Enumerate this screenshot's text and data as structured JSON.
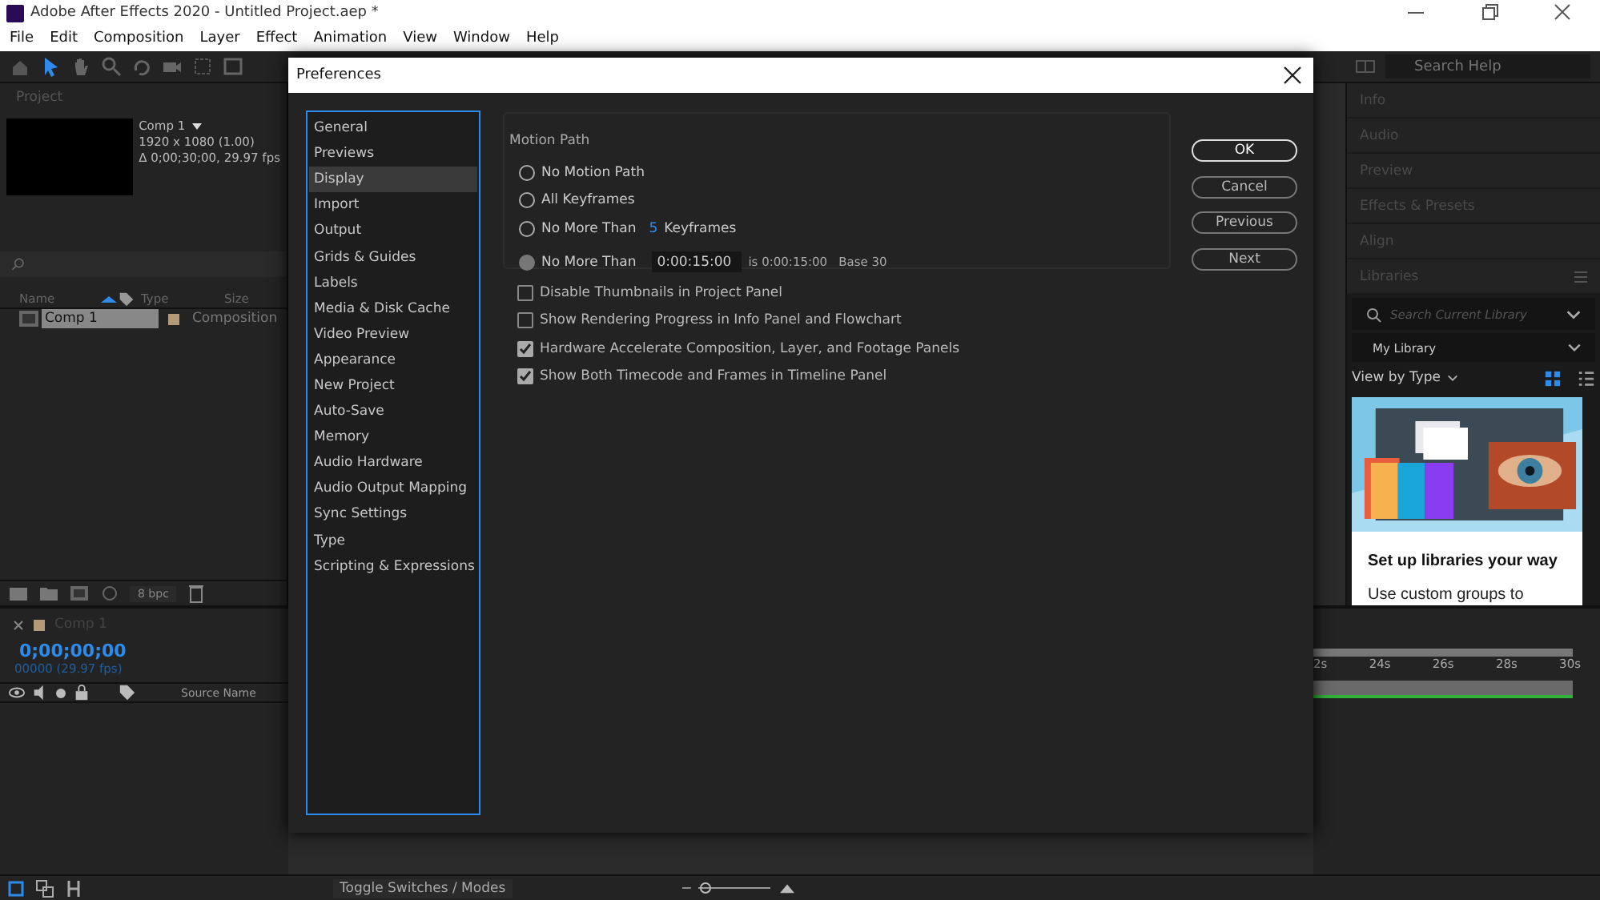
{
  "window": {
    "title": "Adobe After Effects 2020 - Untitled Project.aep *"
  },
  "menu": [
    "File",
    "Edit",
    "Composition",
    "Layer",
    "Effect",
    "Animation",
    "View",
    "Window",
    "Help"
  ],
  "search_help": {
    "placeholder": "Search Help"
  },
  "project_panel": {
    "title": "Project",
    "comp_name": "Comp 1",
    "comp_size": "1920 x 1080 (1.00)",
    "comp_duration": "Δ 0;00;30;00, 29.97 fps",
    "columns": [
      "Name",
      "Type",
      "Size"
    ],
    "rows": [
      {
        "name": "Comp 1",
        "type": "Composition",
        "selected": true
      }
    ],
    "bit_depth": "8 bpc"
  },
  "right_panels": [
    "Info",
    "Audio",
    "Preview",
    "Effects & Presets",
    "Align"
  ],
  "libraries": {
    "title": "Libraries",
    "search_placeholder": "Search Current Library",
    "library": "My Library",
    "view": "View by Type",
    "card_title": "Set up libraries your way",
    "card_text": "Use custom groups to"
  },
  "timeline": {
    "tab": "Comp 1",
    "timecode": "0;00;00;00",
    "frames": "00000 (29.97 fps)",
    "column": "Source Name",
    "ruler": [
      "2s",
      "24s",
      "26s",
      "28s",
      "30s"
    ],
    "toggle": "Toggle Switches / Modes",
    "zoom": {
      "level": 0.1
    }
  },
  "dialog": {
    "title": "Preferences",
    "categories": [
      {
        "label": "General",
        "selected": false
      },
      {
        "label": "Previews",
        "selected": false
      },
      {
        "label": "Display",
        "selected": true
      },
      {
        "label": "Import",
        "selected": false
      },
      {
        "label": "Output",
        "selected": false
      },
      {
        "label": "Grids & Guides",
        "selected": false
      },
      {
        "label": "Labels",
        "selected": false
      },
      {
        "label": "Media & Disk Cache",
        "selected": false
      },
      {
        "label": "Video Preview",
        "selected": false
      },
      {
        "label": "Appearance",
        "selected": false
      },
      {
        "label": "New Project",
        "selected": false
      },
      {
        "label": "Auto-Save",
        "selected": false
      },
      {
        "label": "Memory",
        "selected": false
      },
      {
        "label": "Audio Hardware",
        "selected": false
      },
      {
        "label": "Audio Output Mapping",
        "selected": false
      },
      {
        "label": "Sync Settings",
        "selected": false
      },
      {
        "label": "Type",
        "selected": false
      },
      {
        "label": "Scripting & Expressions",
        "selected": false
      }
    ],
    "motion_path": {
      "title": "Motion Path",
      "options": [
        {
          "kind": "plain",
          "label": "No Motion Path",
          "selected": false
        },
        {
          "kind": "plain",
          "label": "All Keyframes",
          "selected": false
        },
        {
          "kind": "count",
          "label": "No More Than",
          "selected": false,
          "value": "5",
          "unit": "Keyframes"
        },
        {
          "kind": "time",
          "label": "No More Than",
          "selected": true,
          "value": "0:00:15:00",
          "note": "is 0:00:15:00",
          "base": "Base 30"
        }
      ]
    },
    "checkboxes": [
      {
        "label": "Disable Thumbnails in Project Panel",
        "checked": false
      },
      {
        "label": "Show Rendering Progress in Info Panel and Flowchart",
        "checked": false
      },
      {
        "label": "Hardware Accelerate Composition, Layer, and Footage Panels",
        "checked": true
      },
      {
        "label": "Show Both Timecode and Frames in Timeline Panel",
        "checked": true
      }
    ],
    "buttons": [
      {
        "label": "OK",
        "default": true
      },
      {
        "label": "Cancel",
        "default": false
      },
      {
        "label": "Previous",
        "default": false
      },
      {
        "label": "Next",
        "default": false
      }
    ]
  }
}
